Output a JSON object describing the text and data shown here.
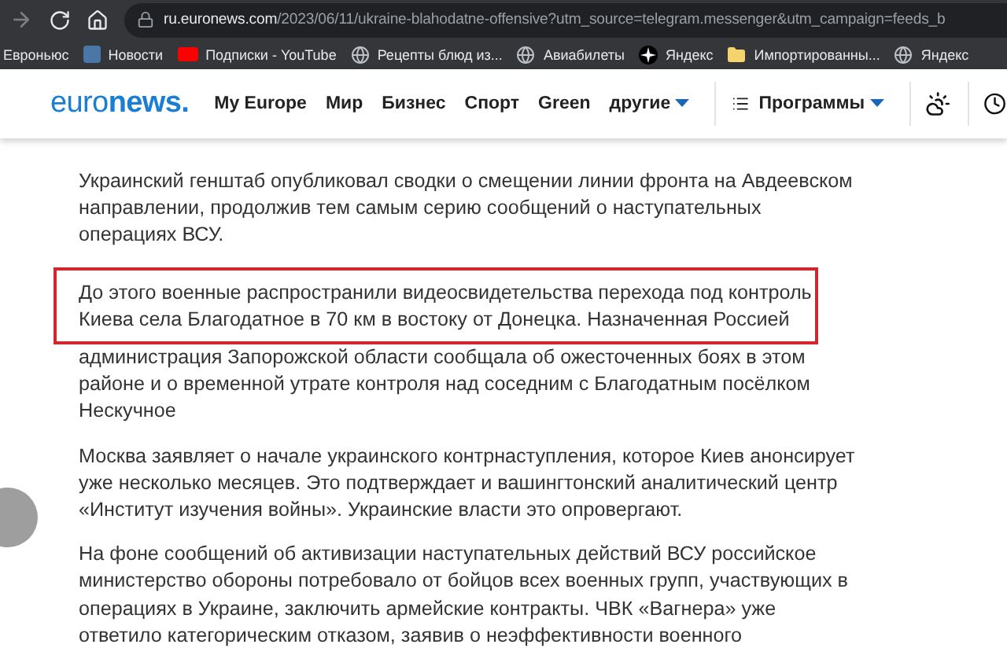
{
  "browser": {
    "url_host": "ru.euronews.com",
    "url_path": "/2023/06/11/ukraine-blahodatne-offensive?utm_source=telegram.messenger&utm_campaign=feeds_b",
    "bookmarks": [
      {
        "kind": "none",
        "label": "Евроньюс"
      },
      {
        "kind": "vk",
        "label": "Новости"
      },
      {
        "kind": "youtube",
        "label": "Подписки - YouTube"
      },
      {
        "kind": "globe",
        "label": "Рецепты блюд из..."
      },
      {
        "kind": "globe",
        "label": "Авиабилеты"
      },
      {
        "kind": "star",
        "label": "Яндекс"
      },
      {
        "kind": "folder",
        "label": "Импортированны..."
      },
      {
        "kind": "globe",
        "label": "Яндекс"
      }
    ]
  },
  "site": {
    "logo_light": "euro",
    "logo_bold": "news.",
    "nav": [
      {
        "label": "My Europe",
        "dropdown": false
      },
      {
        "label": "Мир",
        "dropdown": false
      },
      {
        "label": "Бизнес",
        "dropdown": false
      },
      {
        "label": "Спорт",
        "dropdown": false
      },
      {
        "label": "Green",
        "dropdown": false
      },
      {
        "label": "другие",
        "dropdown": true
      }
    ],
    "programs": "Программы"
  },
  "article": {
    "paragraphs": [
      {
        "lines": [
          {
            "text": "Украинский генштаб опубликовал сводки о смещении линии фронта на Авдеевском",
            "highlighted": false
          },
          {
            "text": "направлении, продолжив тем самым серию сообщений о наступательных",
            "highlighted": false
          },
          {
            "text": "операциях ВСУ.",
            "highlighted": false
          }
        ]
      },
      {
        "lines": [
          {
            "text": "До этого военные распространили видеосвидетельства перехода под контроль",
            "highlighted": true
          },
          {
            "text": "Киева села Благодатное в 70 км в востоку от Донецка. Назначенная Россией",
            "highlighted": true
          },
          {
            "text": "администрация Запорожской области сообщала об ожесточенных боях в этом",
            "highlighted": false
          },
          {
            "text": "районе и о временной утрате контроля над соседним с Благодатным посёлком",
            "highlighted": false
          },
          {
            "text": "Нескучное",
            "highlighted": false
          }
        ]
      },
      {
        "lines": [
          {
            "text": "Москва заявляет о начале украинского контрнаступления, которое Киев анонсирует",
            "highlighted": false
          },
          {
            "text": "уже несколько месяцев. Это подтверждает и вашингтонский аналитический центр",
            "highlighted": false
          },
          {
            "text": "«Институт изучения войны». Украинские власти это опровергают.",
            "highlighted": false
          }
        ]
      },
      {
        "lines": [
          {
            "text": "На фоне сообщений об активизации наступательных действий ВСУ российское",
            "highlighted": false
          },
          {
            "text": "министерство обороны потребовало от бойцов всех военных групп, участвующих в",
            "highlighted": false
          },
          {
            "text": "операциях в Украине, заключить армейские контракты. ЧВК «Вагнера» уже",
            "highlighted": false
          },
          {
            "text": "ответило категорическим отказом, заявив о неэффективности военного",
            "highlighted": false
          }
        ]
      }
    ]
  }
}
